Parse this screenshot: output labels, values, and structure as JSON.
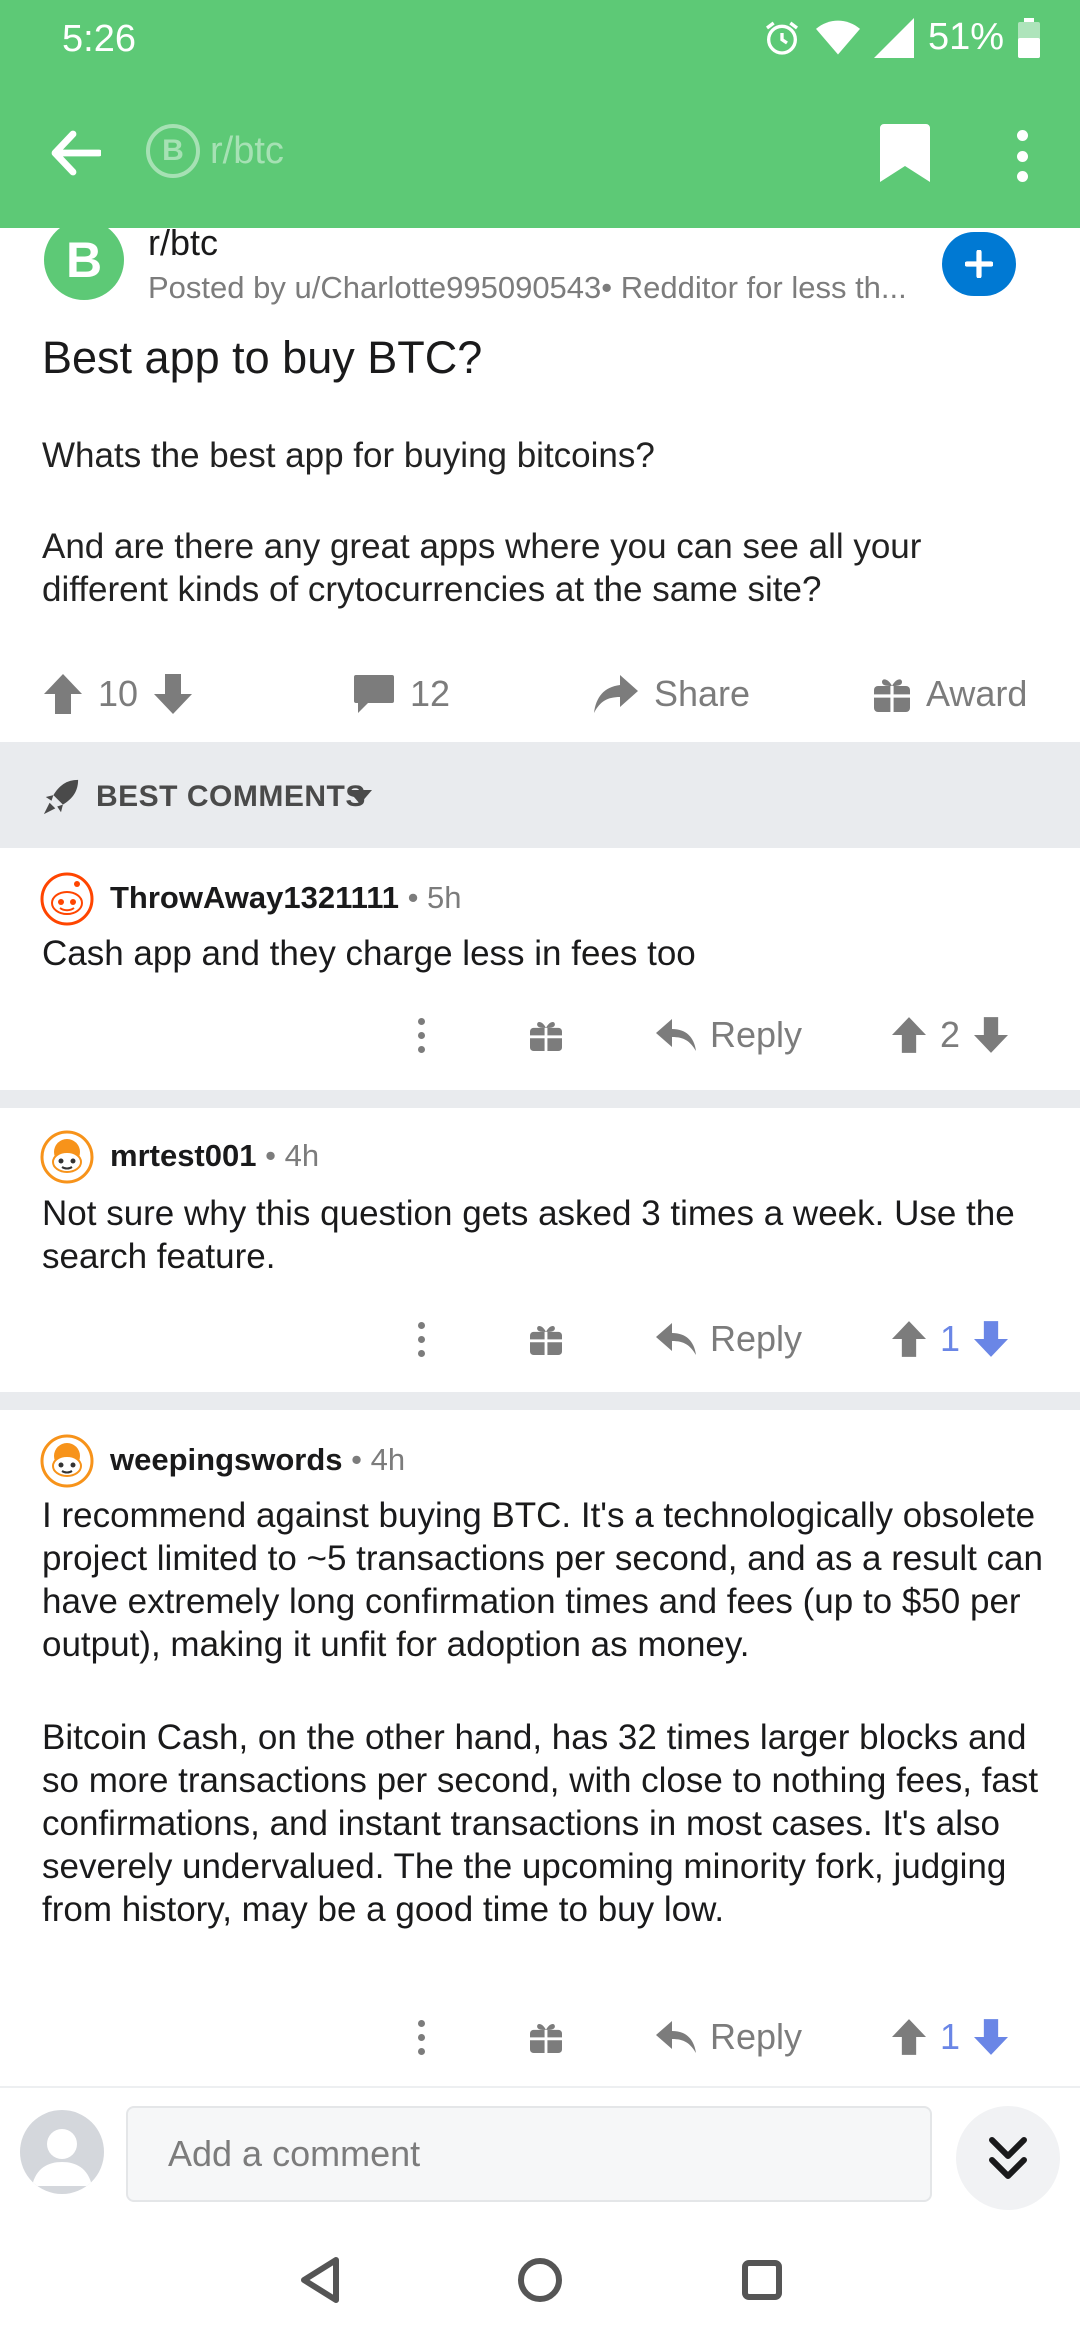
{
  "status_bar": {
    "time": "5:26",
    "battery": "51%"
  },
  "app_bar": {
    "subreddit_title": "r/btc",
    "logo_glyph": "B"
  },
  "post": {
    "subreddit": "r/btc",
    "logo_glyph": "B",
    "posted_by": "Posted by u/Charlotte995090543• Redditor for less th...",
    "title": "Best app to buy BTC?",
    "body": [
      "Whats the best app for buying bitcoins?",
      "And are there any great apps where you can see all your different kinds of crytocurrencies at the same site?"
    ],
    "votes": "10",
    "comments": "12",
    "share_label": "Share",
    "award_label": "Award"
  },
  "sort": {
    "label": "BEST COMMENTS"
  },
  "comments": [
    {
      "author": "ThrowAway1321111",
      "age": "• 5h",
      "body": [
        "Cash app and they charge less in fees too"
      ],
      "reply_label": "Reply",
      "votes": "2",
      "voted": "none"
    },
    {
      "author": "mrtest001",
      "age": "• 4h",
      "body": [
        "Not sure why this question gets asked 3 times a week.  Use the search feature."
      ],
      "reply_label": "Reply",
      "votes": "1",
      "voted": "down"
    },
    {
      "author": "weepingswords",
      "age": "• 4h",
      "body": [
        "I recommend against buying BTC. It's a technologically obsolete project limited to ~5 transactions per second, and as a result can have extremely long confirmation times and fees (up to $50 per output), making it unfit for adoption as money.",
        "Bitcoin Cash, on the other hand, has 32 times larger blocks and so more transactions per second, with close to nothing fees, fast confirmations, and instant transactions in most cases. It's also severely undervalued. The the upcoming minority fork, judging from history, may be a good time to buy low."
      ],
      "reply_label": "Reply",
      "votes": "1",
      "voted": "down"
    }
  ],
  "composer": {
    "placeholder": "Add a comment"
  },
  "colors": {
    "brand_green": "#5dc976",
    "join_blue": "#0079d3",
    "vote_blue": "#6a86e6",
    "muted": "#7c7c7c",
    "divider": "#e9ebee"
  },
  "icons": {
    "back": "arrow-left-icon",
    "bookmark": "bookmark-icon",
    "more": "more-vertical-icon",
    "alarm": "alarm-icon",
    "wifi": "wifi-icon",
    "signal": "signal-icon",
    "battery": "battery-icon"
  }
}
